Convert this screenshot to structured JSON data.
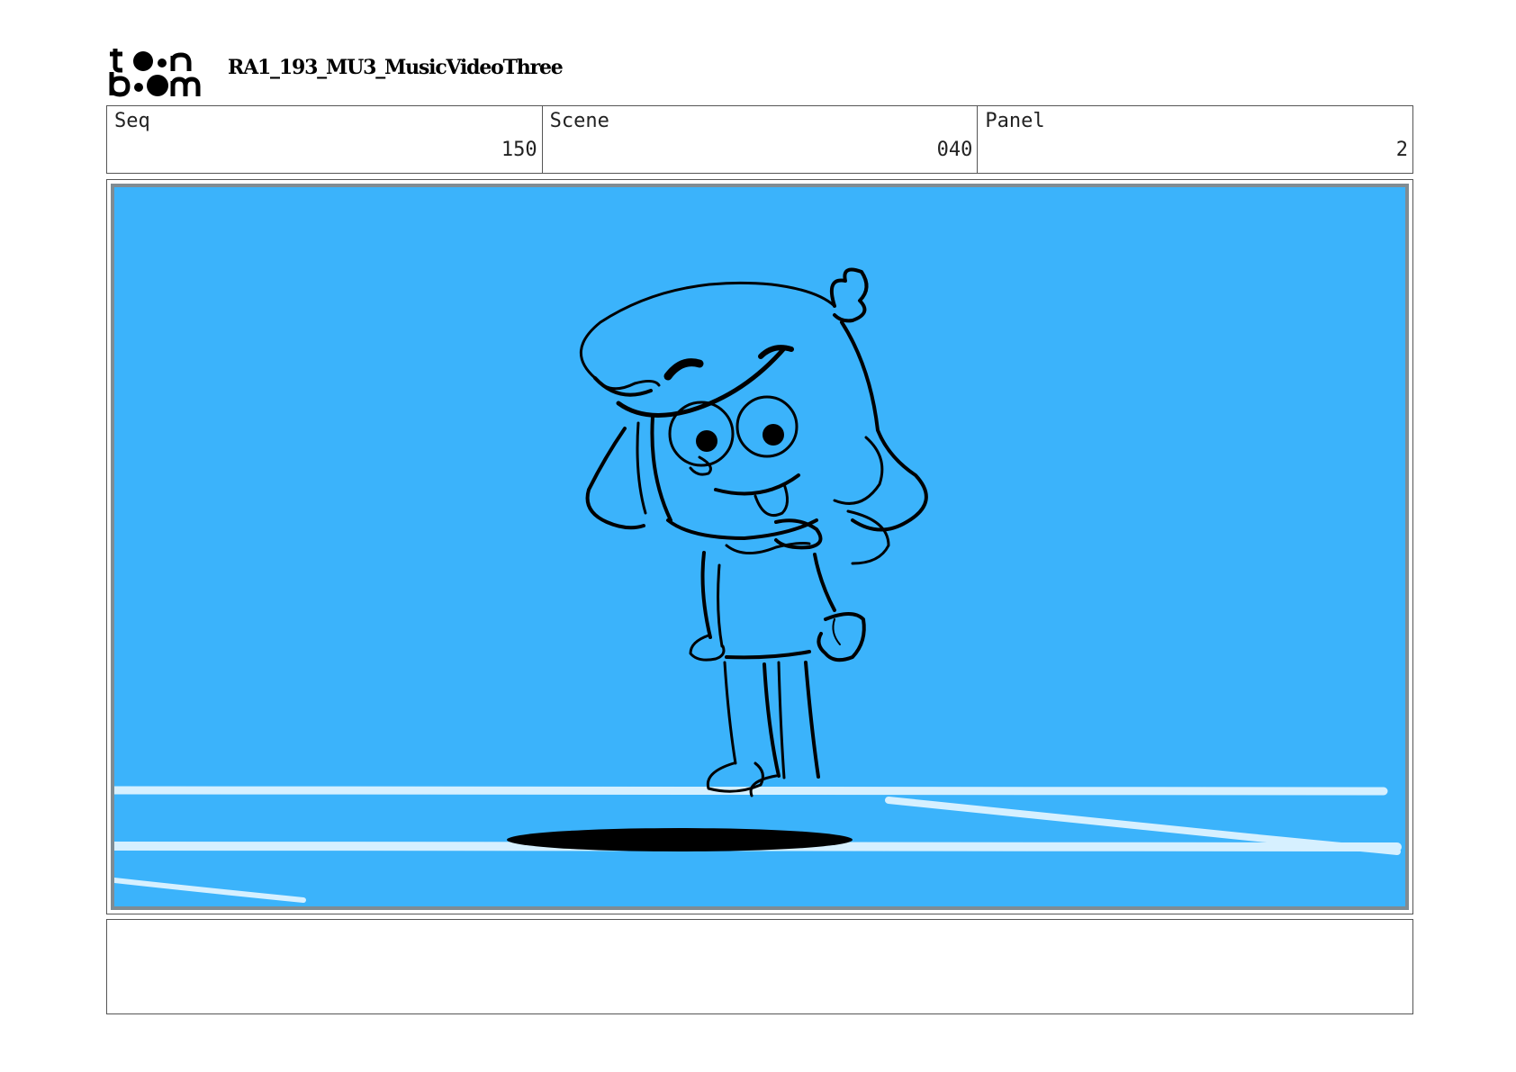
{
  "header": {
    "logo_top": "t••n",
    "logo_bottom": "b••m",
    "project_title": "RA1_193_MU3_MusicVideoThree"
  },
  "info": {
    "seq_label": "Seq",
    "seq_value": "150",
    "scene_label": "Scene",
    "scene_value": "040",
    "panel_label": "Panel",
    "panel_value": "2"
  },
  "panel": {
    "background_color": "#3bb3fb",
    "line_color": "#000000",
    "floor_highlight_color": "#d6f0ff"
  },
  "notes": {
    "text": ""
  }
}
